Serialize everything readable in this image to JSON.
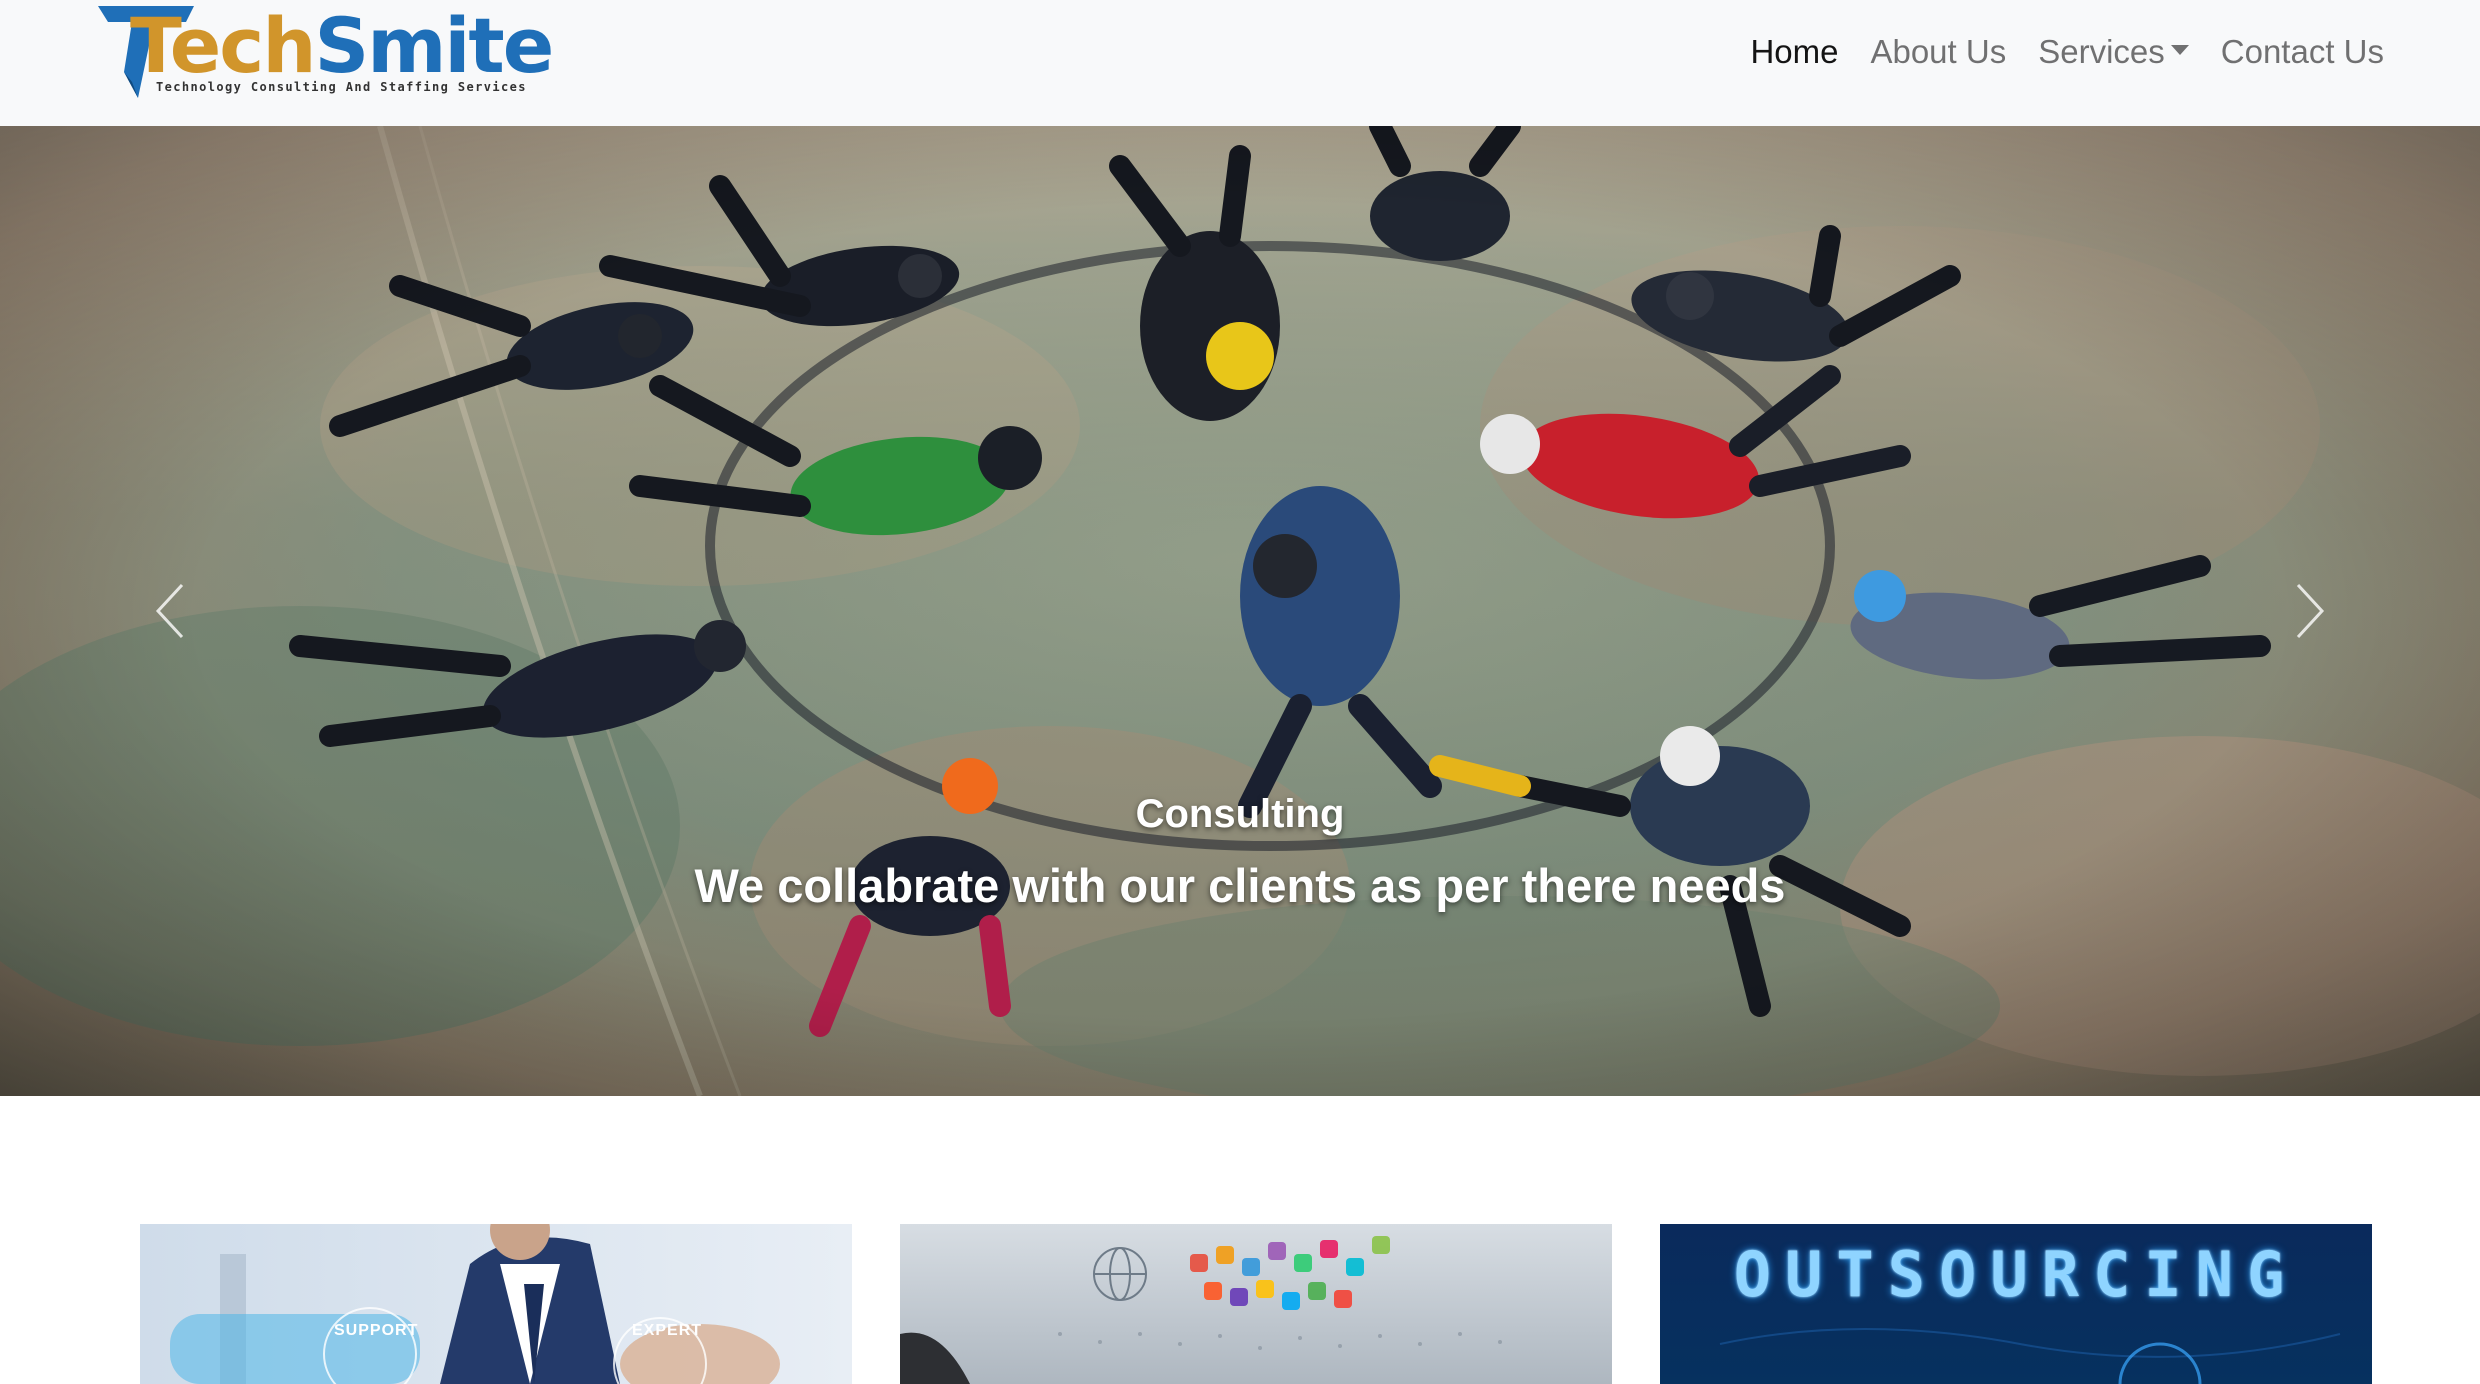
{
  "brand": {
    "name_main": "Tech",
    "name_accent": "Smite",
    "tagline": "Technology Consulting And Staffing Services",
    "colors": {
      "blue": "#1f6fb8",
      "gold": "#d1952b"
    }
  },
  "nav": {
    "items": [
      {
        "label": "Home",
        "active": true
      },
      {
        "label": "About Us",
        "active": false
      },
      {
        "label": "Services",
        "active": false,
        "dropdown": true
      },
      {
        "label": "Contact Us",
        "active": false
      }
    ]
  },
  "carousel": {
    "caption_title": "Consulting",
    "caption_text": "We collabrate with our clients as per there needs",
    "prev_icon": "chevron-left-icon",
    "next_icon": "chevron-right-icon"
  },
  "cards": [
    {
      "image": "business-support-expert",
      "labels": [
        "SUPPORT",
        "EXPERT"
      ]
    },
    {
      "image": "digital-network-globe",
      "labels": []
    },
    {
      "image": "outsourcing-banner",
      "title": "OUTSOURCING"
    }
  ]
}
